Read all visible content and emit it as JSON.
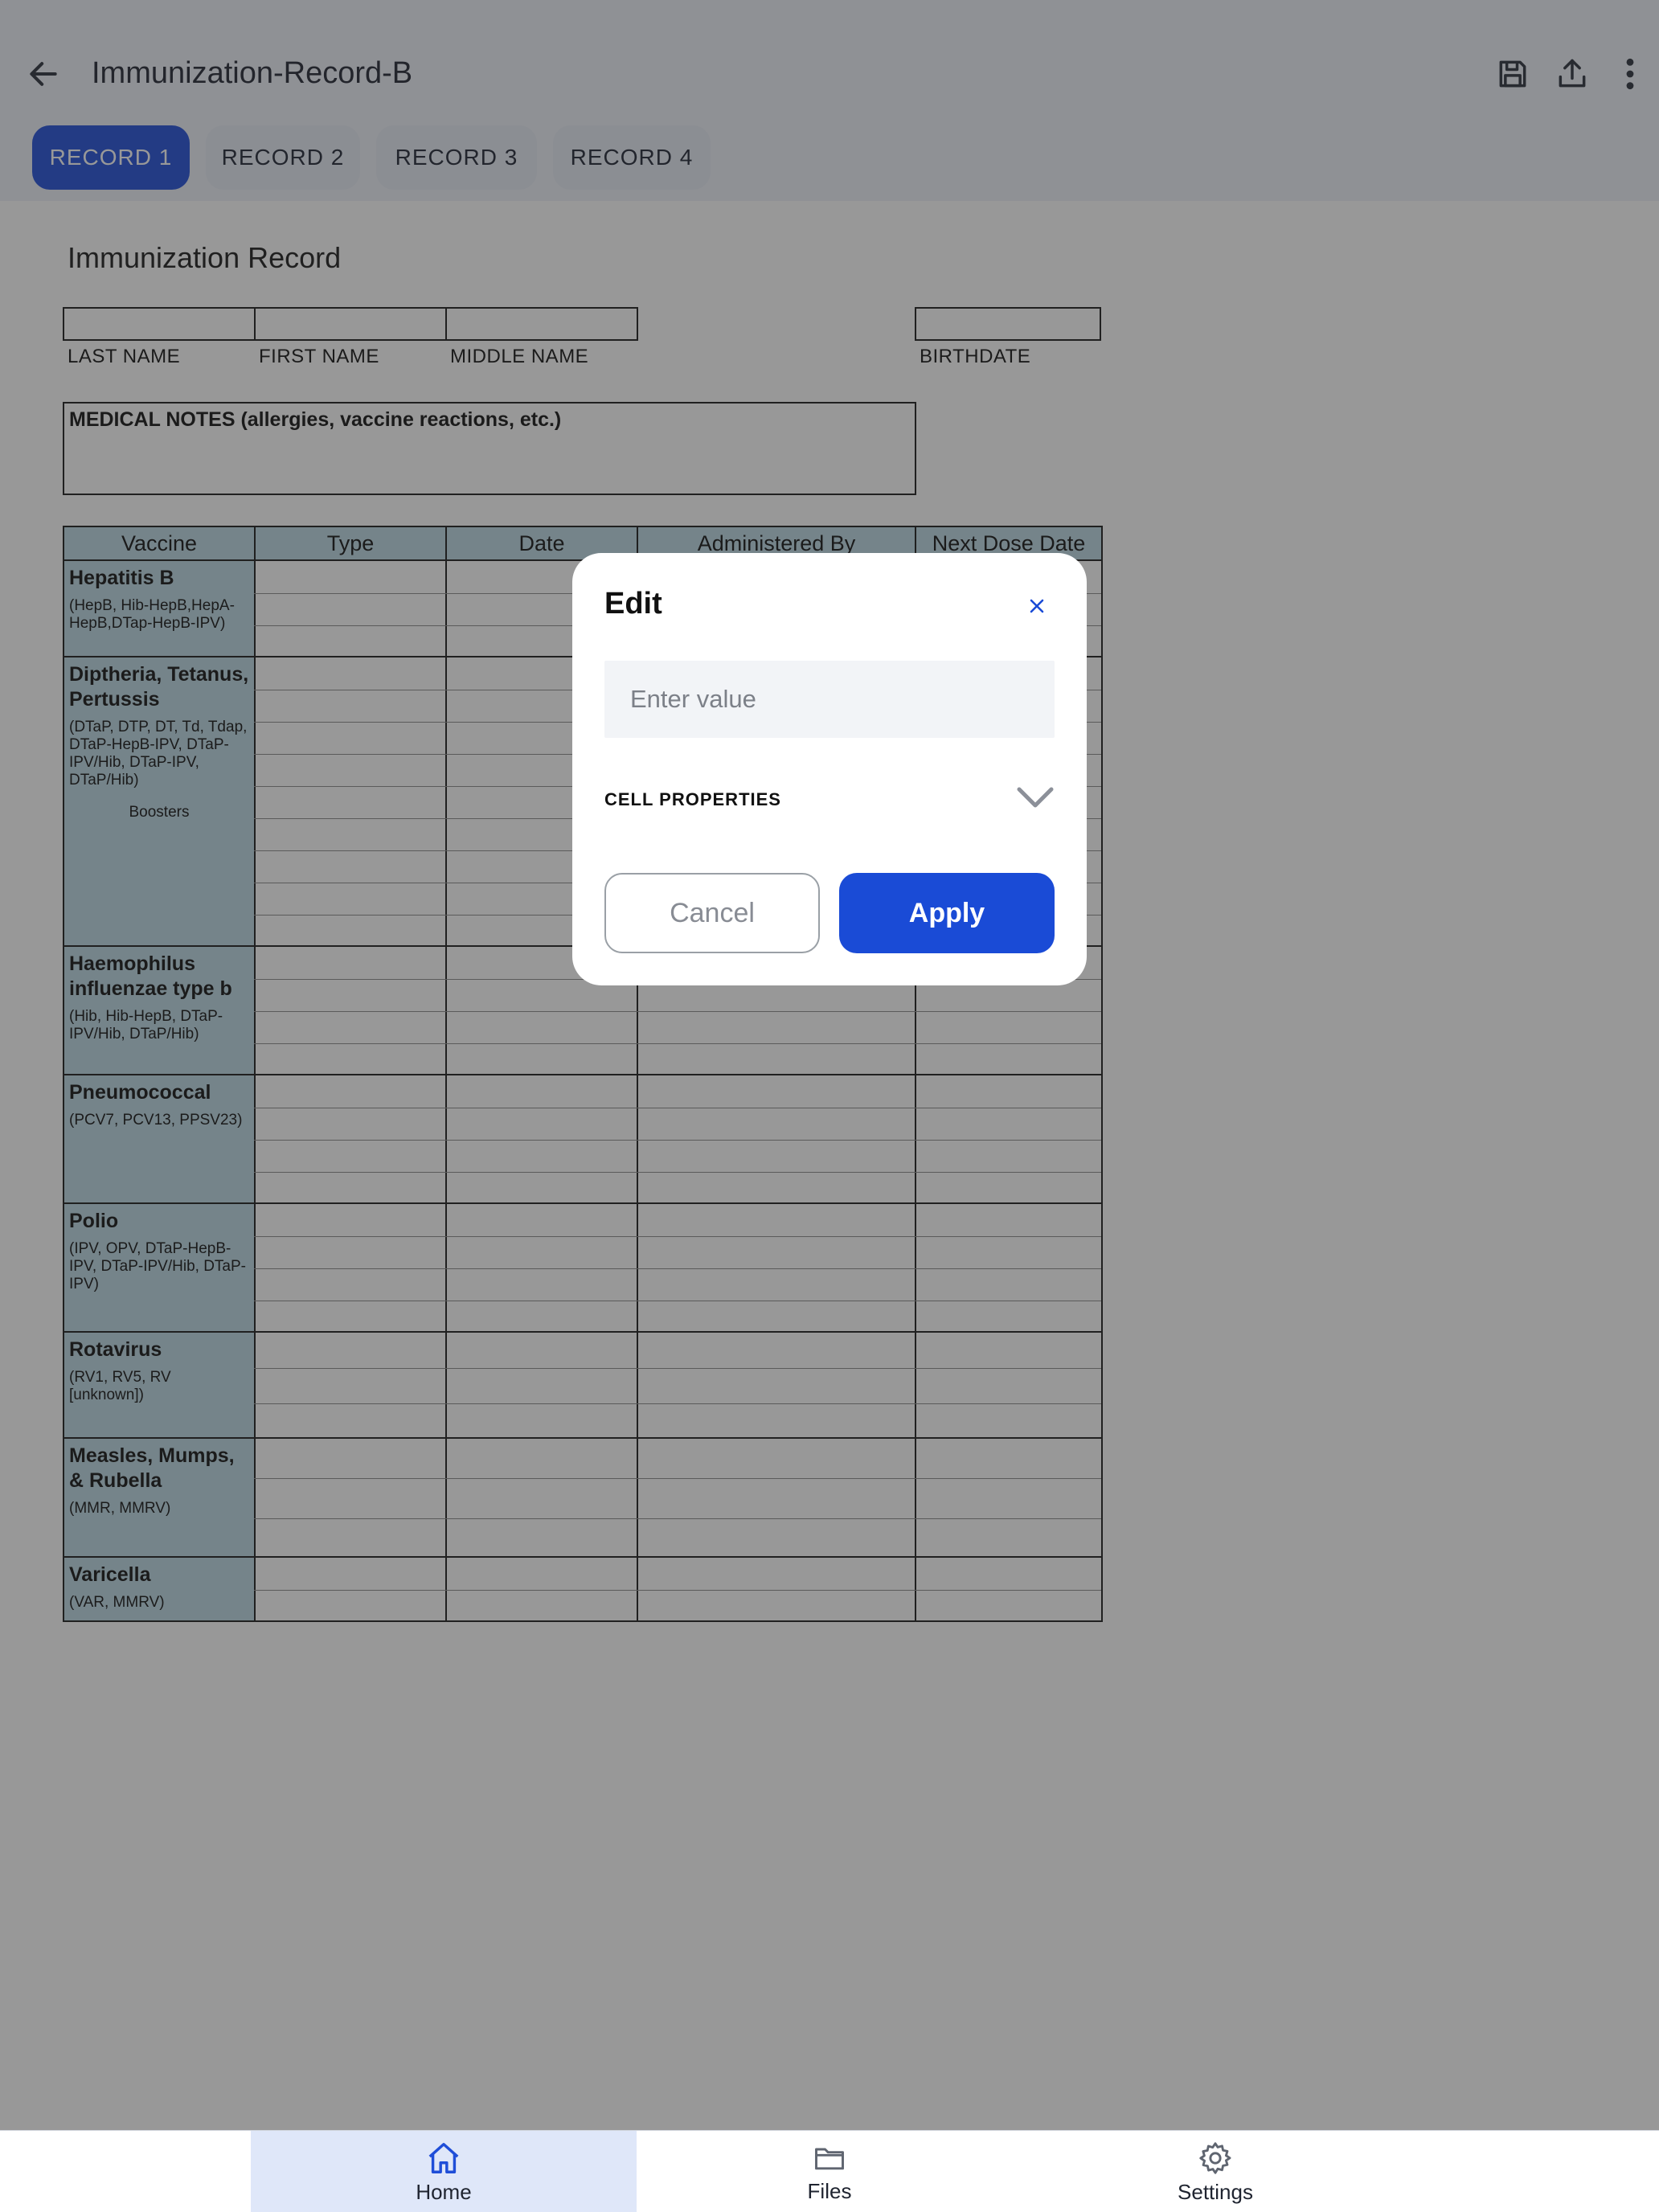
{
  "header": {
    "title": "Immunization-Record-B",
    "icons": [
      "back-arrow-icon",
      "save-icon",
      "share-icon",
      "more-vertical-icon"
    ]
  },
  "tabs": [
    {
      "label": "RECORD 1",
      "active": true
    },
    {
      "label": "RECORD 2",
      "active": false
    },
    {
      "label": "RECORD 3",
      "active": false
    },
    {
      "label": "RECORD 4",
      "active": false
    }
  ],
  "form": {
    "heading": "Immunization Record",
    "name_fields": {
      "last": "LAST NAME",
      "first": "FIRST NAME",
      "middle": "MIDDLE NAME",
      "birthdate": "BIRTHDATE"
    },
    "medical_notes_label": "MEDICAL NOTES (allergies, vaccine reactions, etc.)",
    "columns": [
      "Vaccine",
      "Type",
      "Date",
      "Administered By",
      "Next Dose Date"
    ],
    "vaccines": [
      {
        "name": "Hepatitis B",
        "types": "(HepB, Hib-HepB,HepA-HepB,DTap-HepB-IPV)",
        "extra": "",
        "rows": 3
      },
      {
        "name": "Diptheria, Tetanus, Pertussis",
        "types": "(DTaP, DTP, DT, Td, Tdap, DTaP-HepB-IPV, DTaP-IPV/Hib, DTaP-IPV, DTaP/Hib)",
        "extra": "Boosters",
        "rows": 9
      },
      {
        "name": "Haemophilus influenzae type b",
        "types": "(Hib, Hib-HepB, DTaP-IPV/Hib, DTaP/Hib)",
        "extra": "",
        "rows": 4
      },
      {
        "name": "Pneumococcal",
        "types": "(PCV7, PCV13, PPSV23)",
        "extra": "",
        "rows": 4
      },
      {
        "name": "Polio",
        "types": "(IPV, OPV, DTaP-HepB-IPV, DTaP-IPV/Hib, DTaP-IPV)",
        "extra": "",
        "rows": 4
      },
      {
        "name": "Rotavirus",
        "types": "(RV1, RV5, RV [unknown])",
        "extra": "",
        "rows": 3
      },
      {
        "name": "Measles, Mumps, & Rubella",
        "types": "(MMR, MMRV)",
        "extra": "",
        "rows": 3
      },
      {
        "name": "Varicella",
        "types": "(VAR, MMRV)",
        "extra": "",
        "rows": 2
      }
    ]
  },
  "modal": {
    "title": "Edit",
    "input_placeholder": "Enter value",
    "input_value": "",
    "section_label": "CELL PROPERTIES",
    "cancel_label": "Cancel",
    "apply_label": "Apply",
    "accent_color": "#1a4bd6"
  },
  "bottom_nav": [
    {
      "label": "Home",
      "icon": "home-icon",
      "active": true
    },
    {
      "label": "Files",
      "icon": "folder-icon",
      "active": false
    },
    {
      "label": "Settings",
      "icon": "gear-icon",
      "active": false
    }
  ]
}
